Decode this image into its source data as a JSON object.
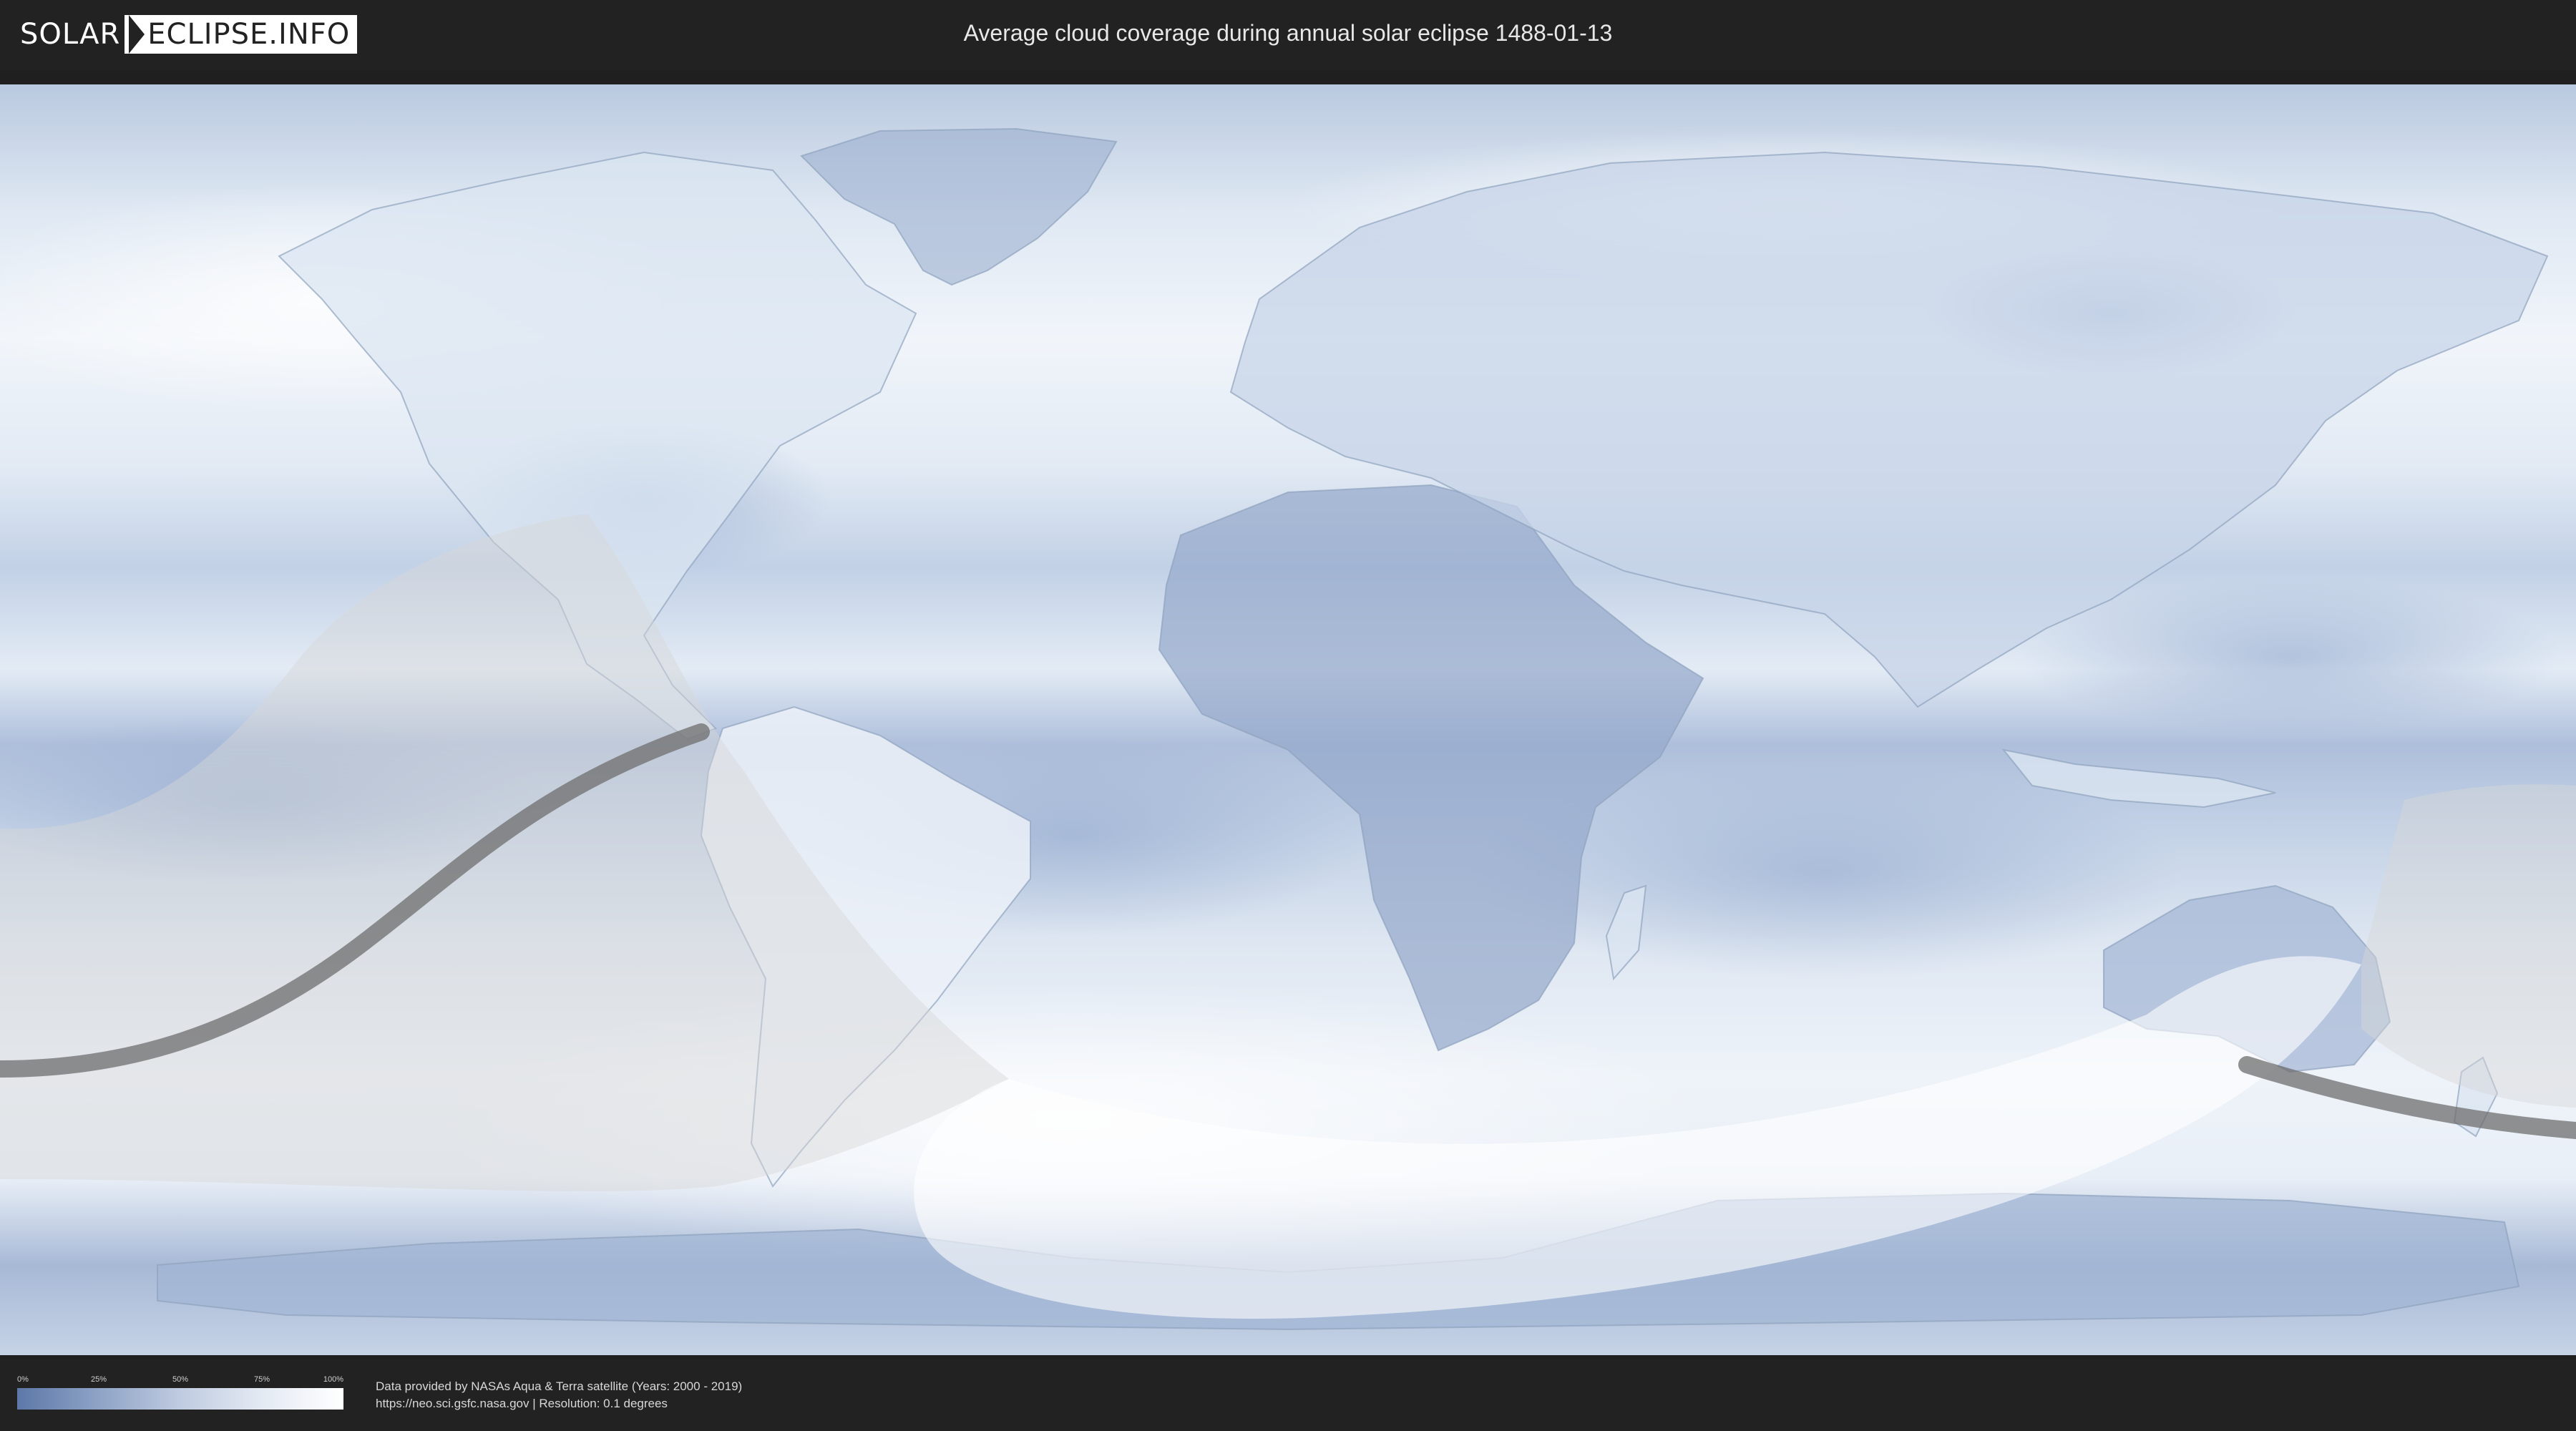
{
  "header": {
    "logo_left": "SOLAR",
    "logo_right": "ECLIPSE.INFO",
    "title": "Average cloud coverage during annual solar eclipse 1488-01-13"
  },
  "map": {
    "colors": {
      "ocean_clear": "#7f99c4",
      "cloud_full": "#ffffff",
      "eclipse_zone": "#ffffff",
      "central_path": "#6e6e6e",
      "coastline": "#8fa2bd"
    }
  },
  "legend": {
    "ticks": [
      "0%",
      "25%",
      "50%",
      "75%",
      "100%"
    ],
    "gradient_colors": [
      "#5d78a8",
      "#8ea3c6",
      "#bfcbe0",
      "#e4eaf3",
      "#ffffff"
    ]
  },
  "credits": {
    "line1": "Data provided by NASAs Aqua & Terra satellite (Years: 2000 - 2019)",
    "line2": "https://neo.sci.gsfc.nasa.gov | Resolution: 0.1 degrees"
  }
}
